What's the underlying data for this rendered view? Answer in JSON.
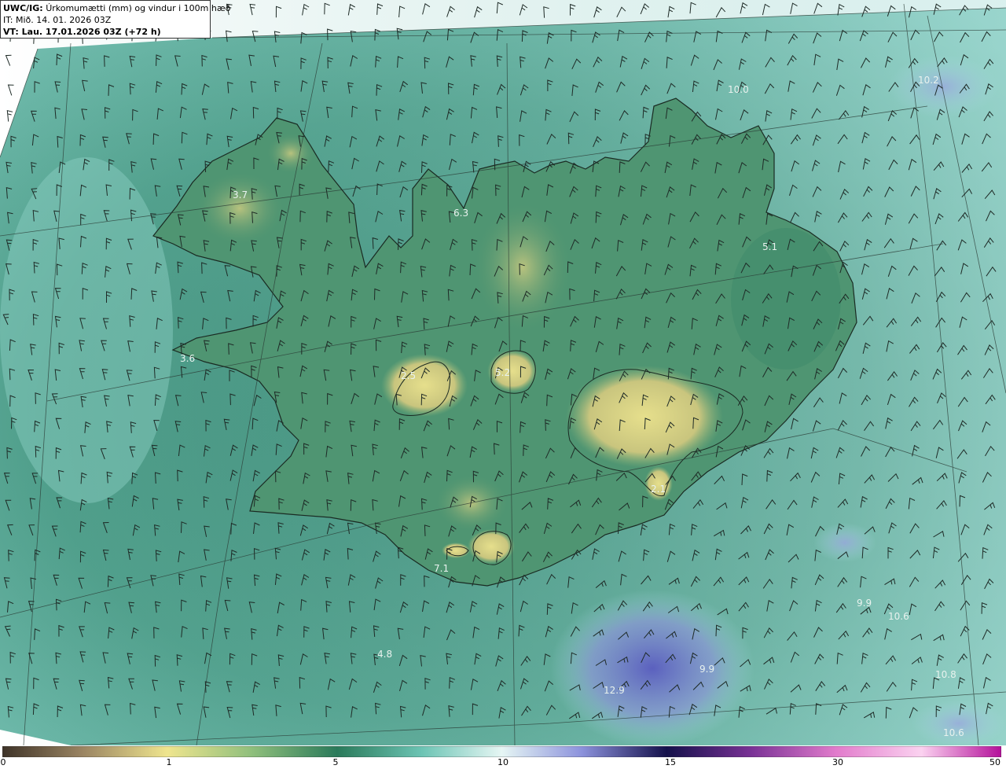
{
  "header": {
    "product": "UWC/IG:",
    "title": "Úrkomumætti (mm) og vindur i 100m hæð",
    "it_line": "IT: Mið. 14. 01. 2026 03Z",
    "vt_line": "VT: Lau. 17.01.2026 03Z (+72 h)"
  },
  "colorbar": {
    "ticks": [
      "0",
      "1",
      "5",
      "10",
      "15",
      "30",
      "50"
    ],
    "colors": [
      "#4a3b2e",
      "#b59a6a",
      "#e8e08a",
      "#7dbb7a",
      "#2f7d5e",
      "#7fd0c0",
      "#e8f6f4",
      "#9aa0e0",
      "#2a2a9a",
      "#1a1060",
      "#8a3a9a",
      "#e070c8",
      "#ffc8f0",
      "#c020a0"
    ]
  },
  "map": {
    "legend_colors": {
      "land_high": "#d9d27e",
      "land_mid": "#5f9c72",
      "sea_low": "#3f8a78",
      "sea_high": "#8ed4cc",
      "heavy": "#6a6cc8"
    },
    "values": [
      {
        "label": "10.0",
        "id": "ne-sea"
      },
      {
        "label": "10.2",
        "id": "far-ne"
      },
      {
        "label": "3.7",
        "id": "westfjords"
      },
      {
        "label": "6.3",
        "id": "north"
      },
      {
        "label": "5.1",
        "id": "east"
      },
      {
        "label": "3.6",
        "id": "snaefellsnes"
      },
      {
        "label": "2.5",
        "id": "langjokull"
      },
      {
        "label": "5.2",
        "id": "hofsjokull"
      },
      {
        "label": "2.1",
        "id": "vatnajokull-south"
      },
      {
        "label": "7.1",
        "id": "south-coast"
      },
      {
        "label": "4.8",
        "id": "south-sea"
      },
      {
        "label": "12.9",
        "id": "se-sea"
      },
      {
        "label": "9.9",
        "id": "se-sea-2"
      },
      {
        "label": "10.6",
        "id": "far-se"
      },
      {
        "label": "9.9",
        "id": "far-se-2"
      },
      {
        "label": "10.8",
        "id": "far-se-3"
      },
      {
        "label": "10.6",
        "id": "bottom-right"
      }
    ]
  }
}
